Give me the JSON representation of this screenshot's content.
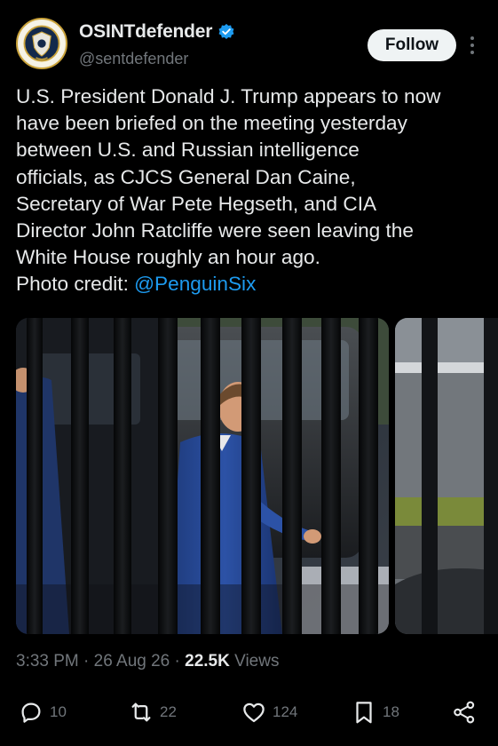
{
  "author": {
    "display_name": "OSINTdefender",
    "handle": "@sentdefender",
    "verified": true,
    "avatar_icon": "shield-seal-icon"
  },
  "follow_button": {
    "label": "Follow"
  },
  "more_button": {
    "icon": "more-vertical-icon"
  },
  "tweet": {
    "text_lines": [
      "U.S. President Donald J. Trump appears to now",
      "have been briefed on the meeting yesterday",
      "between U.S. and Russian intelligence",
      "officials, as CJCS General Dan Caine,",
      "Secretary of War Pete Hegseth, and CIA",
      "Director John Ratcliffe were seen leaving the",
      "White House roughly an hour ago."
    ],
    "credit_prefix": "Photo credit: ",
    "credit_mention": "@PenguinSix"
  },
  "meta": {
    "time": "3:33 PM",
    "separator": " · ",
    "date": "26 Aug 26",
    "views_count": "22.5K",
    "views_label": " Views"
  },
  "actions": {
    "reply": {
      "icon": "reply-icon",
      "count": "10"
    },
    "repost": {
      "icon": "repost-icon",
      "count": "22"
    },
    "like": {
      "icon": "heart-icon",
      "count": "124"
    },
    "bookmark": {
      "icon": "bookmark-icon",
      "count": "18"
    },
    "share": {
      "icon": "share-icon"
    }
  },
  "colors": {
    "background": "#000000",
    "text": "#e7e9ea",
    "muted": "#71767b",
    "accent": "#1d9bf0",
    "follow_bg": "#eff3f4"
  }
}
